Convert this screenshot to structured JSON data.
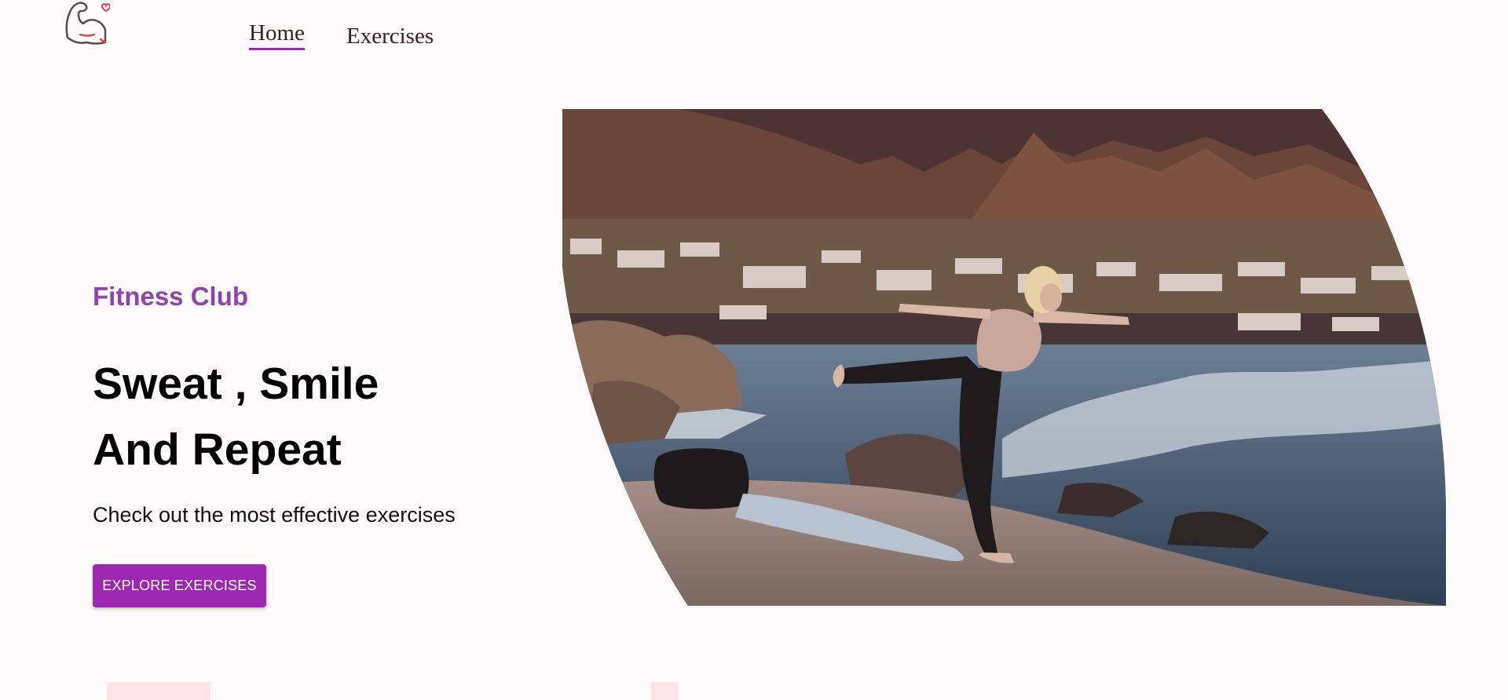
{
  "nav": {
    "logo_icon": "flexed-arm-heart-icon",
    "links": [
      {
        "label": "Home",
        "active": true
      },
      {
        "label": "Exercises",
        "active": false
      }
    ],
    "active_color": "#9c27b0"
  },
  "hero": {
    "subtitle": "Fitness Club",
    "title_line1": "Sweat , Smile",
    "title_line2": "And Repeat",
    "description": "Check out the most effective exercises",
    "cta_label": "EXPLORE EXERCISES",
    "accent_color": "#9c27b0",
    "subtitle_color": "#8e44ad",
    "image_alt": "yoga-pose-by-the-sea-image"
  }
}
